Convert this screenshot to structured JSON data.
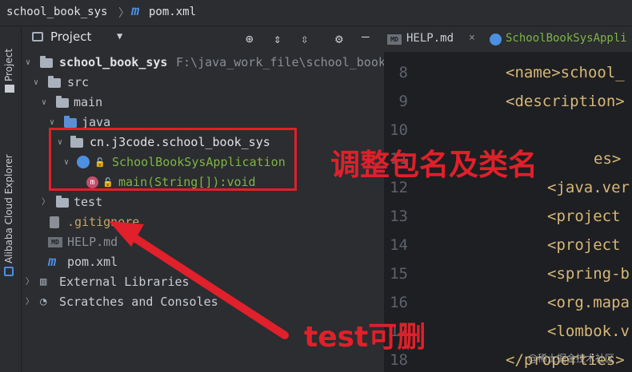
{
  "breadcrumb": {
    "project": "school_book_sys",
    "file": "pom.xml"
  },
  "left_strip": {
    "project_label": "Project",
    "cloud_label": "Alibaba Cloud Explorer"
  },
  "panel": {
    "title": "Project"
  },
  "tree": {
    "root_name": "school_book_sys",
    "root_path": "F:\\java_work_file\\school_book",
    "src": "src",
    "main": "main",
    "java": "java",
    "package": "cn.j3code.school_book_sys",
    "app_class": "SchoolBookSysApplication",
    "main_method": "main(String[]):void",
    "test": "test",
    "gitignore": ".gitignore",
    "help": "HELP.md",
    "pom": "pom.xml",
    "external": "External Libraries",
    "scratches": "Scratches and Consoles"
  },
  "tabs": {
    "help": "HELP.md",
    "app": "SchoolBookSysAppli"
  },
  "editor": {
    "line_numbers": [
      "8",
      "9",
      "10",
      "11",
      "12",
      "13",
      "14",
      "15",
      "16",
      "17",
      "18"
    ],
    "lines": {
      "l8": "<name>school_",
      "l9": "<description>",
      "l11": "es>",
      "l12": "<java.ver",
      "l13": "<project",
      "l14": "<project",
      "l15": "<spring-b",
      "l16": "<org.mapa",
      "l17": "<lombok.v",
      "l18": "</properties>"
    }
  },
  "annotations": {
    "rename_note": "调整包名及类名",
    "test_note": "test可删",
    "watermark": "@稀土掘金技术社区"
  },
  "colors": {
    "accent_red": "#e0202a",
    "background": "#2b2d30",
    "editor_bg": "#1e1f22"
  }
}
